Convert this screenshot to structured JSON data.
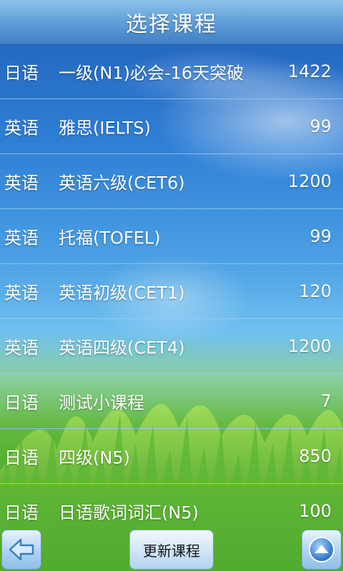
{
  "header": {
    "title": "选择课程"
  },
  "courses": [
    {
      "language": "日语",
      "name": "一级(N1)必会-16天突破",
      "count": "1422"
    },
    {
      "language": "英语",
      "name": "雅思(IELTS)",
      "count": "99"
    },
    {
      "language": "英语",
      "name": "英语六级(CET6)",
      "count": "1200"
    },
    {
      "language": "英语",
      "name": "托福(TOFEL)",
      "count": "99"
    },
    {
      "language": "英语",
      "name": "英语初级(CET1)",
      "count": "120"
    },
    {
      "language": "英语",
      "name": "英语四级(CET4)",
      "count": "1200"
    },
    {
      "language": "日语",
      "name": "测试小课程",
      "count": "7"
    },
    {
      "language": "日语",
      "name": "四级(N5)",
      "count": "850"
    },
    {
      "language": "日语",
      "name": "日语歌词词汇(N5)",
      "count": "100"
    }
  ],
  "footer": {
    "update_label": "更新课程",
    "back_icon": "arrow-left-icon",
    "top_icon": "arrow-up-icon"
  },
  "colors": {
    "sky": "#2f7fd6",
    "grass": "#4aa82a",
    "title_bar": "#5f9fd8",
    "row_divider": "#a0cdf5"
  }
}
